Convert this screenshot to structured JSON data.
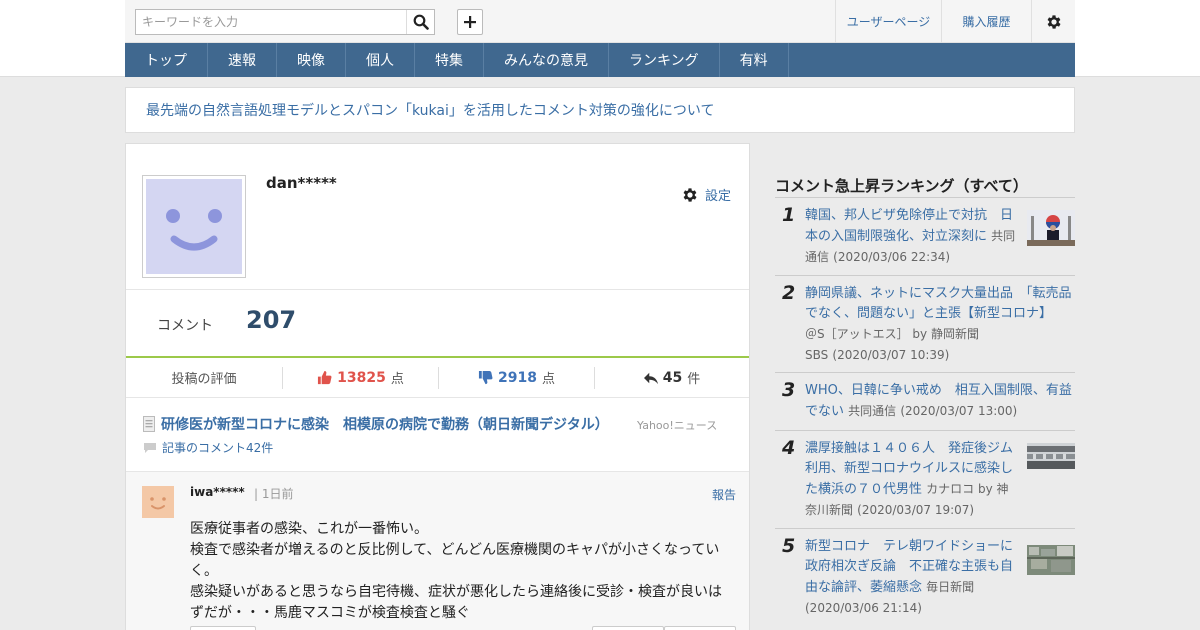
{
  "header": {
    "search_placeholder": "キーワードを入力",
    "user_page": "ユーザーページ",
    "purchase_history": "購入履歴"
  },
  "nav": [
    "トップ",
    "速報",
    "映像",
    "個人",
    "特集",
    "みんなの意見",
    "ランキング",
    "有料"
  ],
  "notice": "最先端の自然言語処理モデルとスパコン「kukai」を活用したコメント対策の強化について",
  "profile": {
    "username": "dan*****",
    "settings_label": "設定",
    "comment_label": "コメント",
    "comment_count": "207"
  },
  "evaluation": {
    "label": "投稿の評価",
    "likes": "13825",
    "dislikes": "2918",
    "point_unit": "点",
    "replies": "45",
    "reply_unit": "件"
  },
  "article": {
    "title": "研修医が新型コロナに感染　相模原の病院で勤務（朝日新聞デジタル）",
    "source": "Yahoo!ニュース",
    "comment_link": "記事のコメント42件"
  },
  "comment": {
    "user": "iwa*****",
    "separator": "|",
    "time": "1日前",
    "report": "報告",
    "lines": [
      "医療従事者の感染、これが一番怖い。",
      "検査で感染者が増えるのと反比例して、どんどん医療機関のキャパが小さくなっていく。",
      "感染疑いがあると思うなら自宅待機、症状が悪化したら連絡後に受診・検査が良いはずだが・・・馬鹿マスコミが検査検査と騒ぐ"
    ]
  },
  "ranking": {
    "title": "コメント急上昇ランキング（すべて）",
    "items": [
      {
        "rank": "1",
        "title": "韓国、邦人ビザ免除停止で対抗　日本の入国制限強化、対立深刻に",
        "source": "共同通信",
        "date": "(2020/03/06 22:34)",
        "thumb": "korea-press-photo"
      },
      {
        "rank": "2",
        "title": "静岡県議、ネットにマスク大量出品　「転売品でなく、問題ない」と主張【新型コロナ】",
        "source": "＠S［アットエス］ by 静岡新聞SBS",
        "date": "(2020/03/07 10:39)",
        "thumb": ""
      },
      {
        "rank": "3",
        "title": "WHO、日韓に争い戒め　相互入国制限、有益でない",
        "source": "共同通信",
        "date": "(2020/03/07 13:00)",
        "thumb": ""
      },
      {
        "rank": "4",
        "title": "濃厚接触は１４０６人　発症後ジム利用、新型コロナウイルスに感染した横浜の７０代男性",
        "source": "カナロコ by 神奈川新聞",
        "date": "(2020/03/07 19:07)",
        "thumb": "gym-building-photo"
      },
      {
        "rank": "5",
        "title": "新型コロナ　テレ朝ワイドショーに政府相次ぎ反論　不正確な主張も自由な論評、萎縮懸念",
        "source": "毎日新聞",
        "date": "(2020/03/06 21:14)",
        "thumb": "aerial-city-photo"
      }
    ]
  },
  "colors": {
    "nav_bg": "#40688f",
    "link": "#3a6ea5",
    "like": "#e0534b",
    "dislike": "#3f73b8",
    "accent_line": "#9cc94a",
    "avatar_bg": "#d4d6f2"
  },
  "icons": [
    "search-icon",
    "plus-icon",
    "gear-icon",
    "thumbs-up-icon",
    "thumbs-down-icon",
    "reply-icon",
    "document-icon",
    "speech-bubble-icon"
  ]
}
